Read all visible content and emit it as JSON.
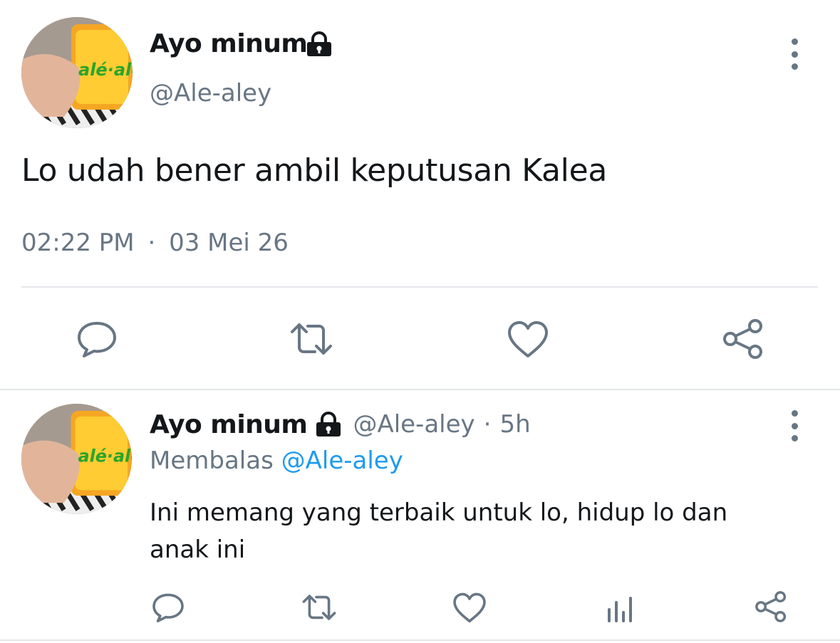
{
  "main_tweet": {
    "display_name": "Ayo minum",
    "handle": "@Ale-aley",
    "text": "Lo udah bener ambil keputusan Kalea",
    "time": "02:22 PM",
    "separator": "·",
    "date": "03 Mei 26",
    "avatar_label": "alé-alé"
  },
  "reply_tweet": {
    "display_name": "Ayo minum",
    "handle": "@Ale-aley",
    "separator": "·",
    "age": "5h",
    "replying_prefix": "Membalas",
    "replying_to": "@Ale-aley",
    "text_line1": "Ini memang yang terbaik untuk lo, hidup lo dan",
    "text_line2": "anak ini",
    "avatar_label": "alé-alé"
  },
  "colors": {
    "text": "#14171a",
    "muted": "#687684",
    "link": "#1d9bf0",
    "divider": "#e4e7ea"
  },
  "icons": [
    "lock-icon",
    "more-vertical-icon",
    "reply-icon",
    "retweet-icon",
    "like-icon",
    "share-icon",
    "analytics-icon"
  ]
}
